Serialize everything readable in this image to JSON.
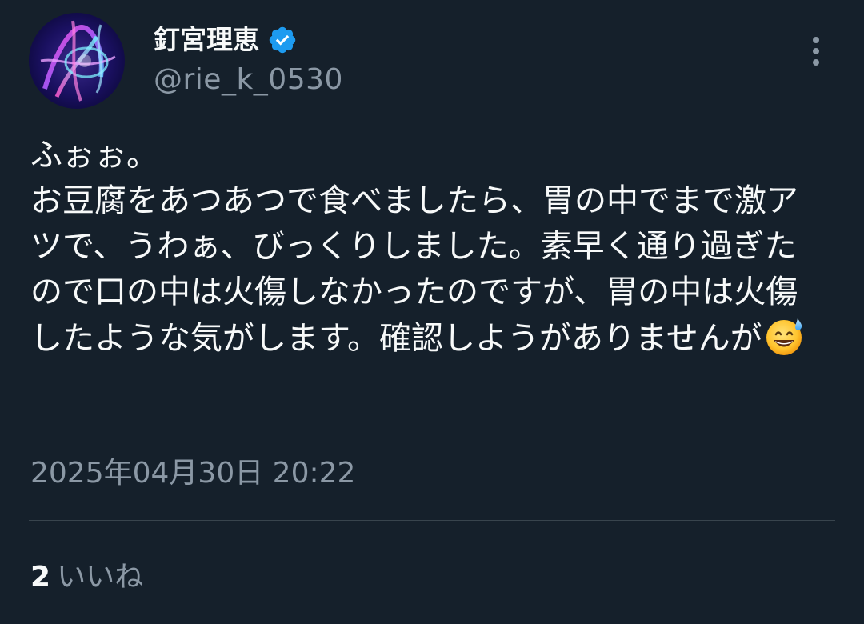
{
  "author": {
    "display_name": "釘宮理恵",
    "handle": "@rie_k_0530",
    "verified": true,
    "avatar_icon": "avatar-neon-light-art"
  },
  "tweet": {
    "text": "ふぉぉ。\nお豆腐をあつあつで食べましたら、胃の中でまで激アツで、うわぁ、びっくりしました。素早く通り過ぎたので口の中は火傷しなかったのですが、胃の中は火傷したような気がします。確認しようがありませんが",
    "emoji": "grinning-face-with-sweat-emoji",
    "timestamp": "2025年04月30日 20:22"
  },
  "engagement": {
    "likes_count": "2",
    "likes_label": "いいね"
  },
  "icons": {
    "more": "more-options-icon",
    "verified": "verified-badge-icon"
  },
  "colors": {
    "background": "#15202b",
    "text_primary": "#f7f9f9",
    "text_secondary": "#8b98a5",
    "divider": "#38444d",
    "verified_blue": "#1d9bf0"
  }
}
